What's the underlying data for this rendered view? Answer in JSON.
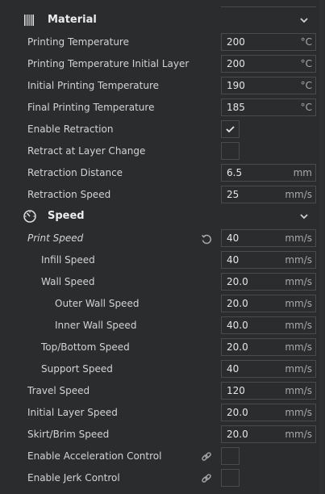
{
  "material": {
    "title": "Material",
    "icon": "spool-icon",
    "rows": [
      {
        "label": "Printing Temperature",
        "value": "200",
        "unit": "°C"
      },
      {
        "label": "Printing Temperature Initial Layer",
        "value": "200",
        "unit": "°C"
      },
      {
        "label": "Initial Printing Temperature",
        "value": "190",
        "unit": "°C"
      },
      {
        "label": "Final Printing Temperature",
        "value": "185",
        "unit": "°C"
      },
      {
        "label": "Enable Retraction",
        "checked": true
      },
      {
        "label": "Retract at Layer Change",
        "checked": false
      },
      {
        "label": "Retraction Distance",
        "value": "6.5",
        "unit": "mm"
      },
      {
        "label": "Retraction Speed",
        "value": "25",
        "unit": "mm/s"
      }
    ]
  },
  "speed": {
    "title": "Speed",
    "icon": "gauge-icon",
    "rows": [
      {
        "label": "Print Speed",
        "value": "40",
        "unit": "mm/s"
      },
      {
        "label": "Infill Speed",
        "value": "40",
        "unit": "mm/s"
      },
      {
        "label": "Wall Speed",
        "value": "20.0",
        "unit": "mm/s"
      },
      {
        "label": "Outer Wall Speed",
        "value": "20.0",
        "unit": "mm/s"
      },
      {
        "label": "Inner Wall Speed",
        "value": "40.0",
        "unit": "mm/s"
      },
      {
        "label": "Top/Bottom Speed",
        "value": "20.0",
        "unit": "mm/s"
      },
      {
        "label": "Support Speed",
        "value": "40",
        "unit": "mm/s"
      },
      {
        "label": "Travel Speed",
        "value": "120",
        "unit": "mm/s"
      },
      {
        "label": "Initial Layer Speed",
        "value": "20.0",
        "unit": "mm/s"
      },
      {
        "label": "Skirt/Brim Speed",
        "value": "20.0",
        "unit": "mm/s"
      },
      {
        "label": "Enable Acceleration Control",
        "checked": false
      },
      {
        "label": "Enable Jerk Control",
        "checked": false
      }
    ]
  },
  "colors": {
    "background": "#2b2c2e",
    "field_border": "#4a4b4e",
    "text": "#d3d3d3",
    "unit_text": "#a9a9a9"
  }
}
